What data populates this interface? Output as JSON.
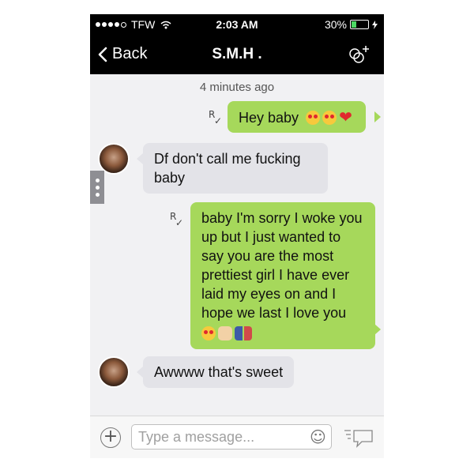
{
  "status_bar": {
    "carrier": "TFW",
    "time": "2:03 AM",
    "battery": "30%",
    "battery_level": 0.3
  },
  "nav": {
    "back_label": "Back",
    "title": "S.M.H ."
  },
  "timestamp": "4 minutes ago",
  "messages": [
    {
      "direction": "outgoing",
      "text": "Hey baby",
      "read_mark": "R",
      "emoji": [
        "smiling-face-with-heart-eyes",
        "smiling-face-with-heart-eyes",
        "red-heart"
      ]
    },
    {
      "direction": "incoming",
      "text": "Df don't call me fucking baby"
    },
    {
      "direction": "outgoing",
      "text": "baby I'm sorry I woke you up but I just wanted to say you are the most prettiest girl I have ever laid my eyes on and I hope we last I love you",
      "read_mark": "R",
      "emoji": [
        "smiling-face-with-heart-eyes",
        "raised-fist",
        "couple-holding-hands"
      ]
    },
    {
      "direction": "incoming",
      "text": "Awwww that's sweet"
    }
  ],
  "composer": {
    "placeholder": "Type a message..."
  },
  "colors": {
    "outgoing_bubble": "#a6d85b",
    "incoming_bubble": "#e3e3e8",
    "bars": "#000000"
  },
  "icons": [
    "signal-dots-icon",
    "wifi-icon",
    "battery-icon",
    "charging-icon",
    "back-chevron-icon",
    "group-add-icon",
    "read-receipt-icon",
    "add-icon",
    "emoji-icon",
    "send-bubble-icon"
  ]
}
